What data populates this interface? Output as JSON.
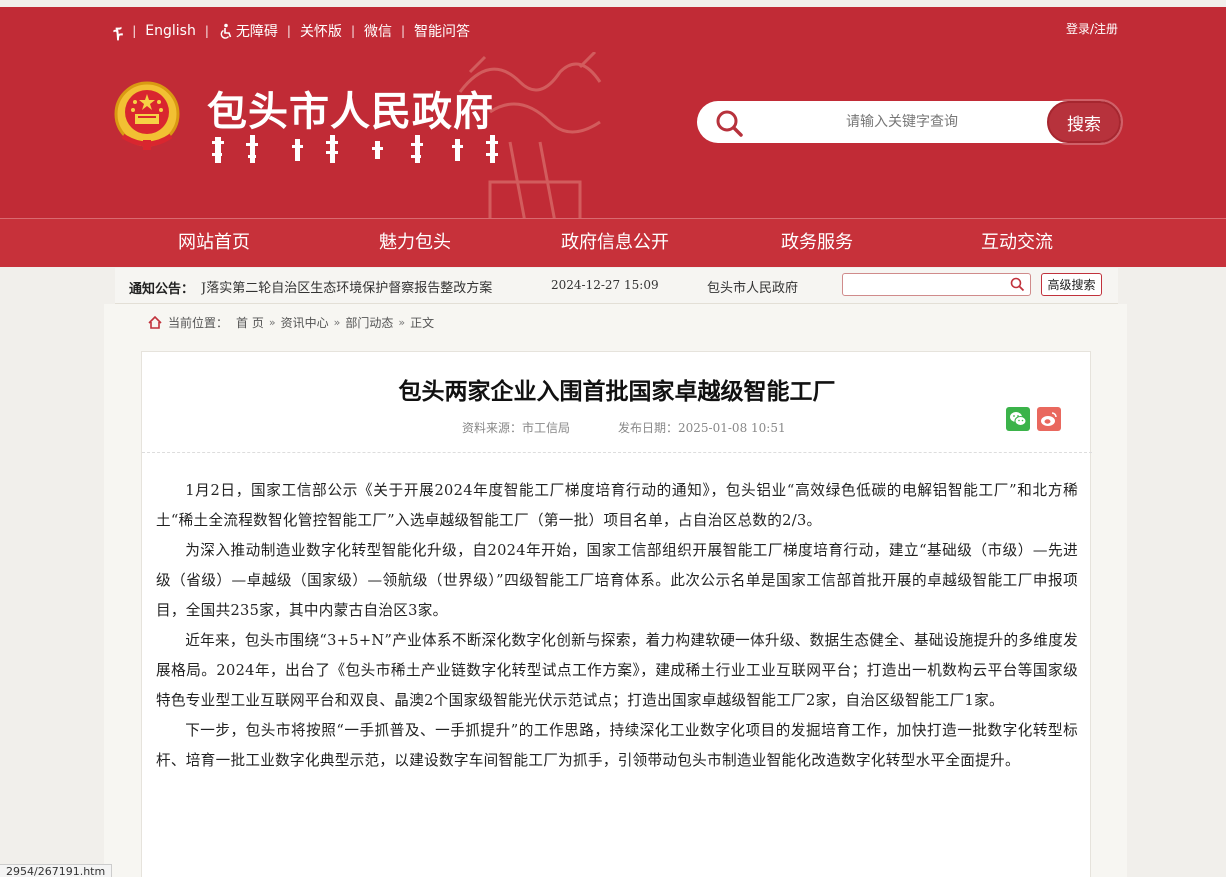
{
  "top_links": {
    "mongolian_glyph": "ᠮ",
    "english": "English",
    "accessibility": "无障碍",
    "care_version": "关怀版",
    "wechat": "微信",
    "smart_qa": "智能问答",
    "login_register": "登录/注册"
  },
  "header": {
    "site_title": "包头市人民政府",
    "search_placeholder": "请输入关键字查询",
    "search_button": "搜索"
  },
  "nav": {
    "items": [
      "网站首页",
      "魅力包头",
      "政府信息公开",
      "政务服务",
      "互动交流"
    ]
  },
  "notice": {
    "label": "通知公告：",
    "text": "J落实第二轮自治区生态环境保护督察报告整改方案",
    "date": "2024-12-27 15:09",
    "org": "包头市人民政府",
    "advanced_search": "高级搜索"
  },
  "breadcrumb": {
    "prefix": "当前位置：",
    "items": [
      "首 页",
      "资讯中心",
      "部门动态",
      "正文"
    ],
    "separator": "»"
  },
  "article": {
    "title": "包头两家企业入围首批国家卓越级智能工厂",
    "source": "资料来源：市工信局",
    "date": "发布日期：2025-01-08 10:51",
    "paragraphs": [
      "1月2日，国家工信部公示《关于开展2024年度智能工厂梯度培育行动的通知》，包头铝业“高效绿色低碳的电解铝智能工厂”和北方稀土“稀土全流程数智化管控智能工厂”入选卓越级智能工厂（第一批）项目名单，占自治区总数的2/3。",
      "为深入推动制造业数字化转型智能化升级，自2024年开始，国家工信部组织开展智能工厂梯度培育行动，建立“基础级（市级）—先进级（省级）—卓越级（国家级）—领航级（世界级）”四级智能工厂培育体系。此次公示名单是国家工信部首批开展的卓越级智能工厂申报项目，全国共235家，其中内蒙古自治区3家。",
      "近年来，包头市围绕“3+5+N”产业体系不断深化数字化创新与探索，着力构建软硬一体升级、数据生态健全、基础设施提升的多维度发展格局。2024年，出台了《包头市稀土产业链数字化转型试点工作方案》，建成稀土行业工业互联网平台；打造出一机数构云平台等国家级特色专业型工业互联网平台和双良、晶澳2个国家级智能光伏示范试点；打造出国家卓越级智能工厂2家，自治区级智能工厂1家。",
      "下一步，包头市将按照“一手抓普及、一手抓提升”的工作思路，持续深化工业数字化项目的发掘培育工作，加快打造一批数字化转型标杆、培育一批工业数字化典型示范，以建设数字车间智能工厂为抓手，引领带动包头市制造业智能化改造数字化转型水平全面提升。"
    ]
  },
  "status_bar": {
    "url": "2954/267191.htm"
  },
  "colors": {
    "header_red": "#c12b36",
    "nav_red": "#c7313a",
    "wechat_green": "#3bb34a",
    "weibo_red": "#e9685e"
  },
  "icons": [
    "mongolian-script-icon",
    "accessibility-icon",
    "emblem-icon",
    "search-icon",
    "home-icon",
    "wechat-icon",
    "weibo-icon"
  ]
}
